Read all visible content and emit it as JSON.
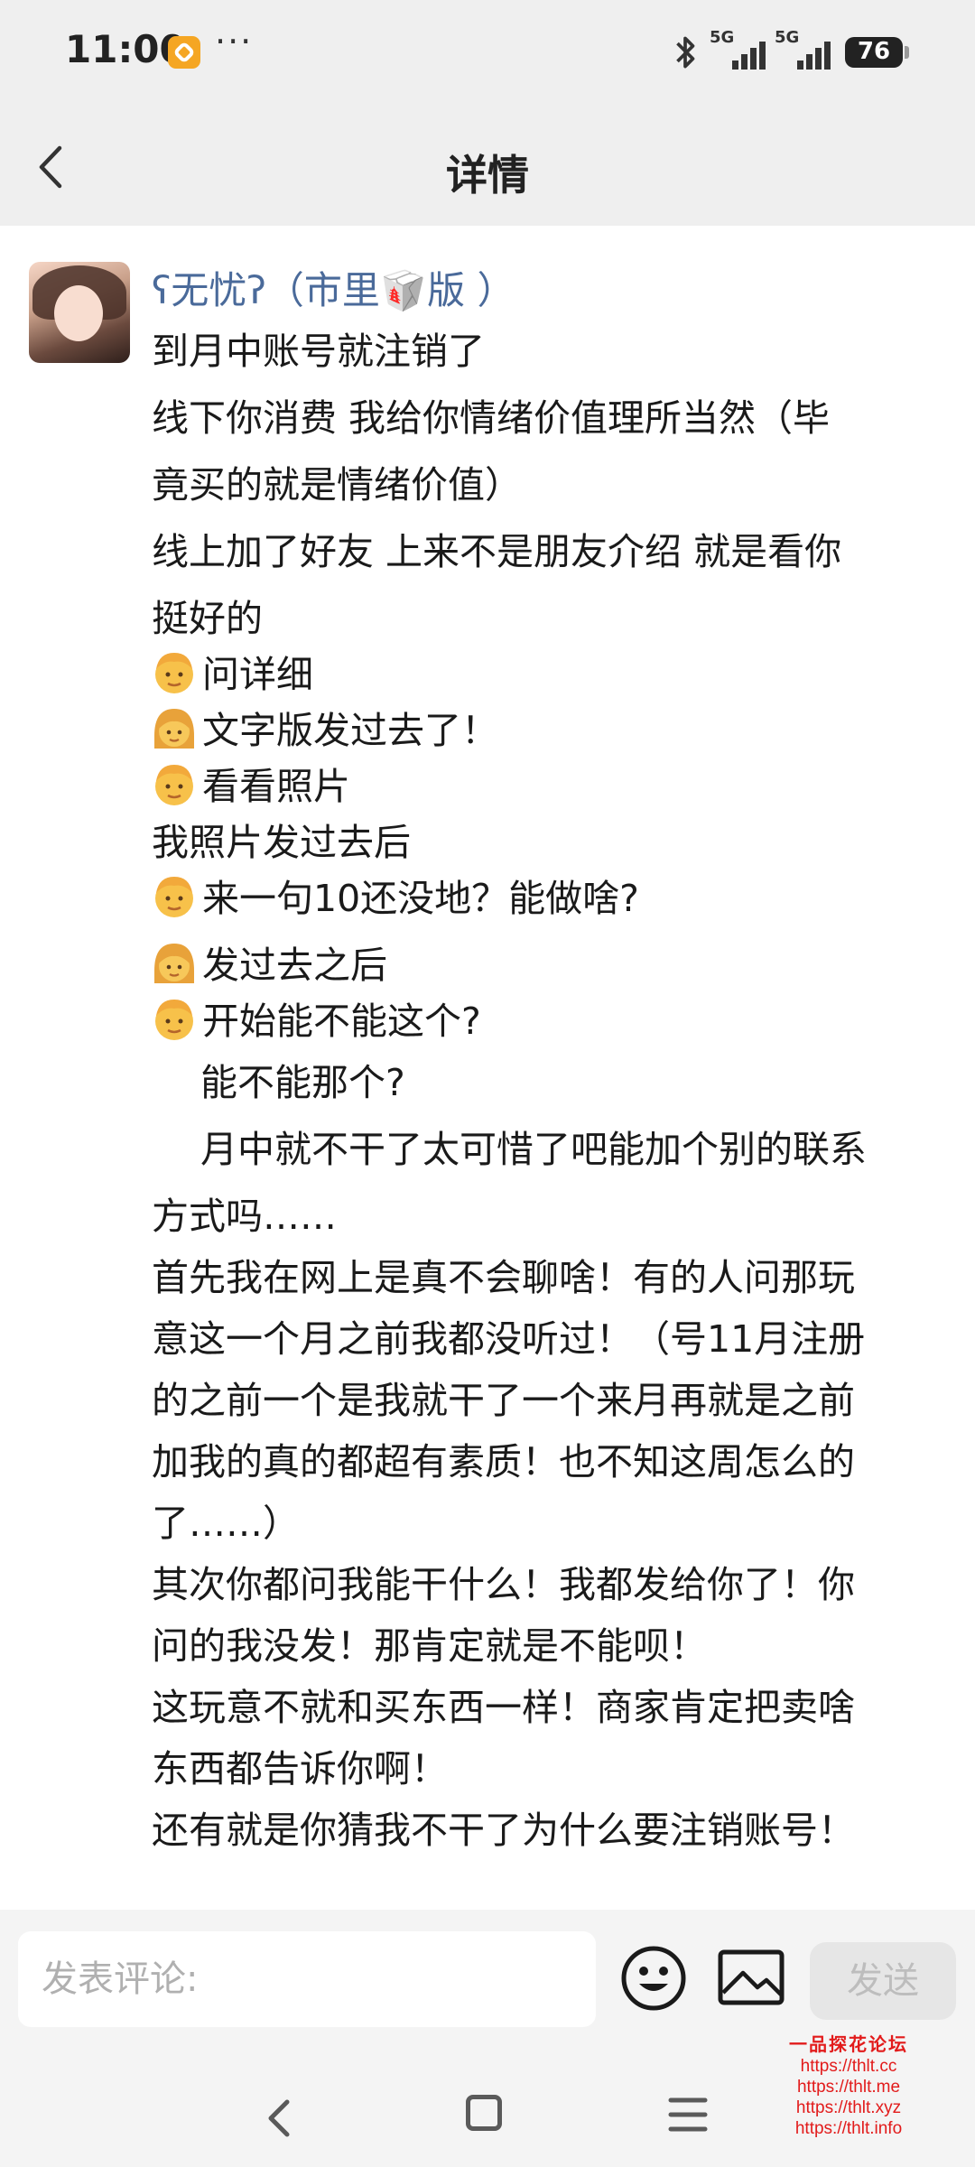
{
  "status_bar": {
    "time": "11:00",
    "more": "···",
    "sim1_tag": "5G",
    "sim2_tag": "5G",
    "battery": "76"
  },
  "header": {
    "title": "详情",
    "icons": {
      "back": "chevron-left-icon"
    }
  },
  "post": {
    "username": "ʕ无忧ʔ（市里🥡版 ）",
    "lines": [
      {
        "emoji": "",
        "text": "到月中账号就注销了"
      },
      {
        "emoji": "",
        "text": "线下你消费 我给你情绪价值理所当然（毕"
      },
      {
        "emoji": "",
        "text": "竟买的就是情绪价值）"
      },
      {
        "emoji": "",
        "text": "线上加了好友 上来不是朋友介绍 就是看你"
      },
      {
        "emoji": "",
        "text": "挺好的"
      },
      {
        "emoji": "man",
        "text": "问详细"
      },
      {
        "emoji": "woman",
        "text": "文字版发过去了！"
      },
      {
        "emoji": "man",
        "text": "看看照片"
      },
      {
        "emoji": "",
        "text": "我照片发过去后"
      },
      {
        "emoji": "man",
        "text": "来一句10还没地？能做啥?"
      },
      {
        "emoji": "woman",
        "text": "发过去之后"
      },
      {
        "emoji": "man",
        "text": "开始能不能这个?"
      },
      {
        "emoji": "",
        "text": "能不能那个?"
      },
      {
        "emoji": "",
        "text": "月中就不干了太可惜了吧能加个别的联系"
      },
      {
        "emoji": "",
        "text": "方式吗……"
      },
      {
        "emoji": "",
        "text": "首先我在网上是真不会聊啥！有的人问那玩"
      },
      {
        "emoji": "",
        "text": "意这一个月之前我都没听过！（号11月注册"
      },
      {
        "emoji": "",
        "text": "的之前一个是我就干了一个来月再就是之前"
      },
      {
        "emoji": "",
        "text": "加我的真的都超有素质！也不知这周怎么的"
      },
      {
        "emoji": "",
        "text": "了……）"
      },
      {
        "emoji": "",
        "text": "其次你都问我能干什么！我都发给你了！你"
      },
      {
        "emoji": "",
        "text": "问的我没发！那肯定就是不能呗！"
      },
      {
        "emoji": "",
        "text": "这玩意不就和买东西一样！商家肯定把卖啥"
      },
      {
        "emoji": "",
        "text": "东西都告诉你啊！"
      },
      {
        "emoji": "",
        "text": "还有就是你猜我不干了为什么要注销账号！"
      }
    ]
  },
  "comment_bar": {
    "placeholder": "发表评论:",
    "send_label": "发送",
    "icons": {
      "emoji": "smiley-icon",
      "image": "image-icon"
    }
  },
  "nav_bar": {
    "icons": {
      "back": "nav-back-icon",
      "home": "nav-home-icon",
      "menu": "nav-menu-icon"
    }
  },
  "watermark": {
    "name": "一品探花论坛",
    "urls": [
      "https://thlt.cc",
      "https://thlt.me",
      "https://thlt.xyz",
      "https://thlt.info"
    ]
  },
  "colors": {
    "chrome_bg": "#efefef",
    "username": "#4a6a9a",
    "send_disabled_bg": "#e6e6e6",
    "watermark": "#e21b1b"
  }
}
